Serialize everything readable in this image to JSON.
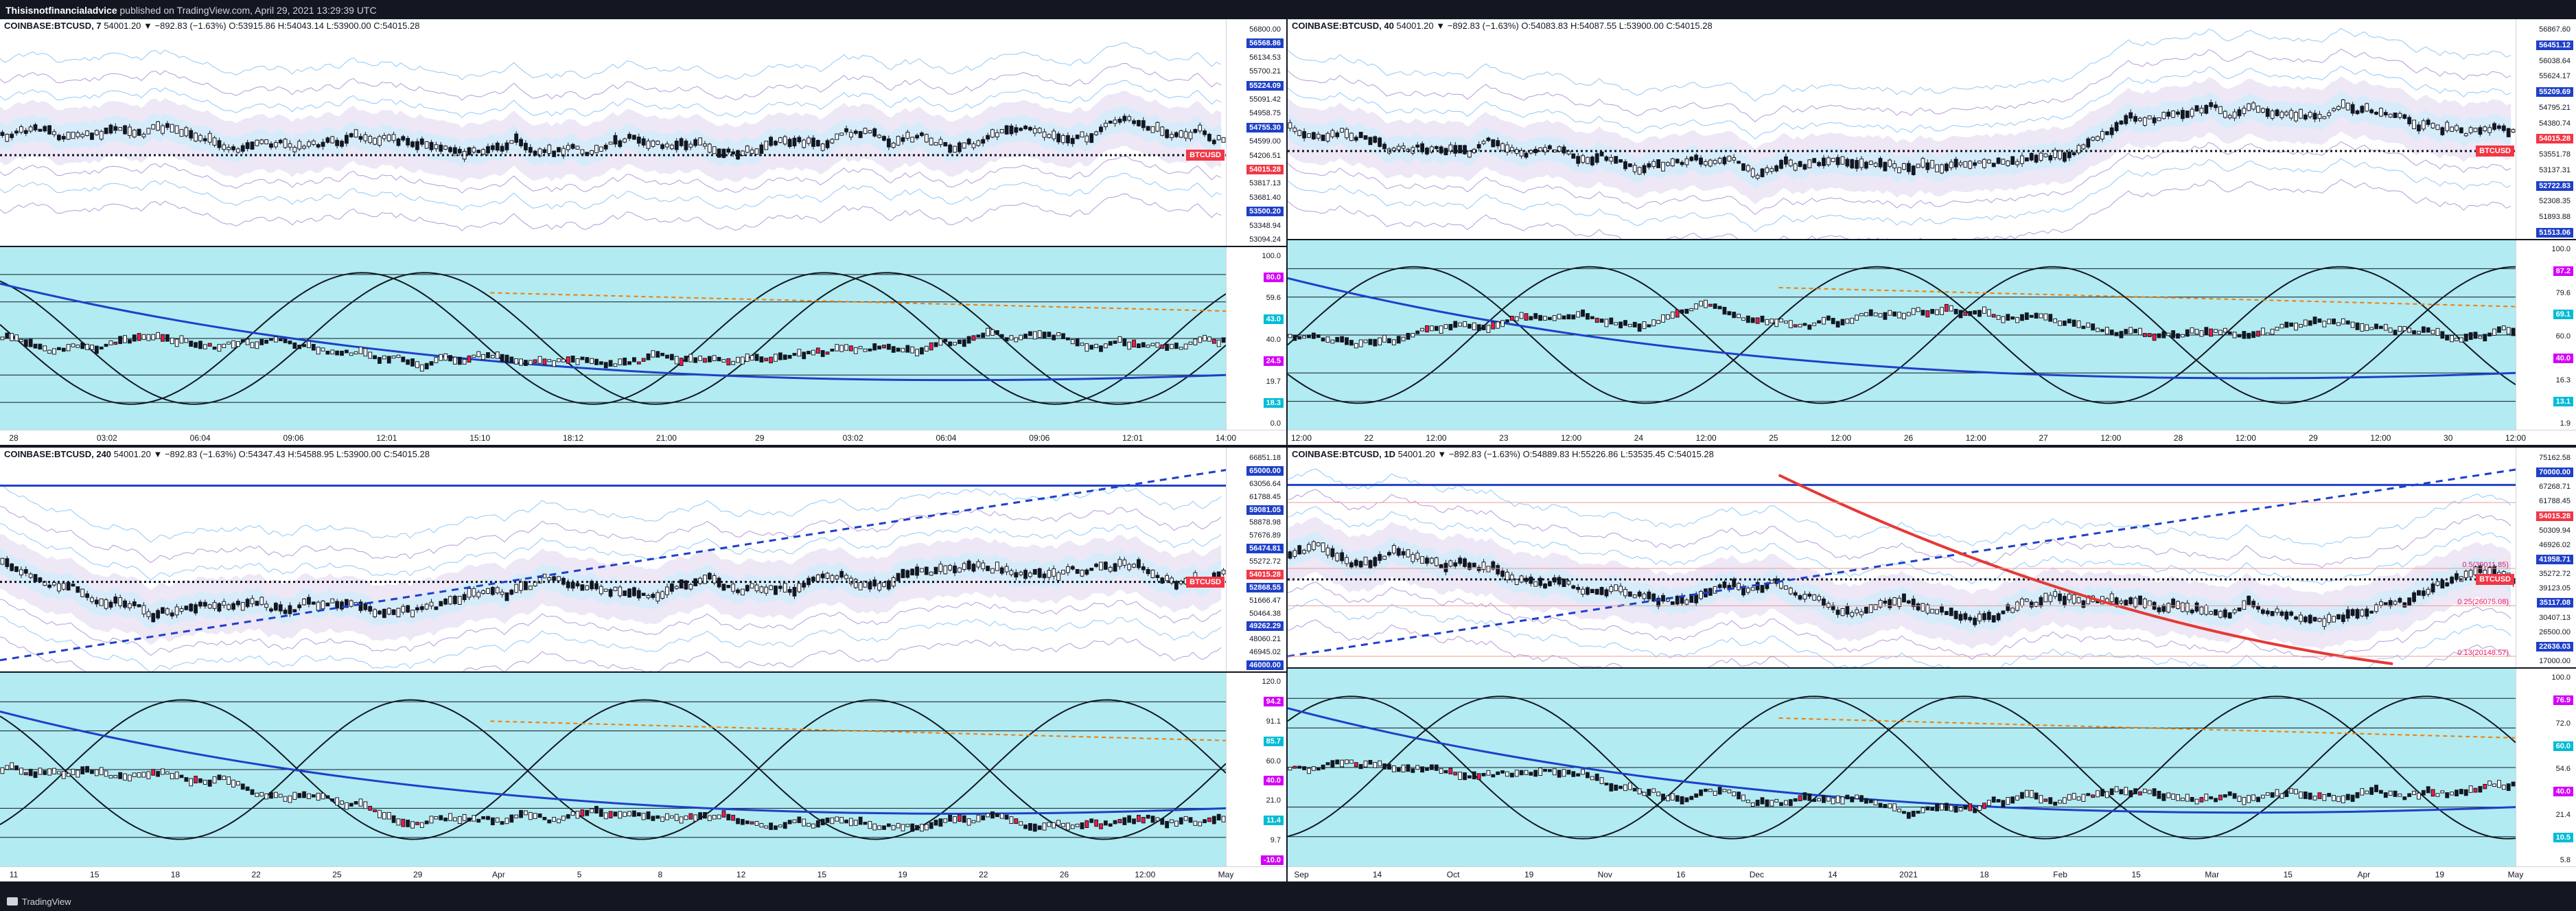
{
  "header": {
    "author": "Thisisnotfinancialadvice",
    "text": " published on TradingView.com, April 29, 2021 13:29:39 UTC"
  },
  "footer": {
    "brand": "TradingView"
  },
  "colors": {
    "up": "#26a69a",
    "down": "#ef5350",
    "cross_high": "#ff1744",
    "osc_bg": "#b2ebf2",
    "band": "#b39ddb",
    "price_tag": "#f23645",
    "dark_tag": "#131722"
  },
  "panels": [
    {
      "id": "p1",
      "symbol": "COINBASE:BTCUSD, 7",
      "ohlc": " 54001.20 ▼ −892.83 (−1.63%) O:53915.86 H:54043.14 L:53900.00 C:54015.28",
      "price_labels": [
        "56800.00",
        "56568.86",
        "56134.53",
        "55700.21",
        "55224.09",
        "55091.42",
        "54958.75",
        "54755.30",
        "54599.00",
        "54206.51",
        "54015.28",
        "53817.13",
        "53681.40",
        "53500.20",
        "53348.94",
        "53094.24"
      ],
      "price_tag": "BTCUSD",
      "price_value": "54015.28",
      "osc_labels": [
        "100.0",
        "80.0",
        "59.6",
        "43.0",
        "40.0",
        "24.5",
        "19.7",
        "18.3",
        "0.0"
      ],
      "x_labels": [
        "28",
        "03:02",
        "06:04",
        "09:06",
        "12:01",
        "15:10",
        "18:12",
        "21:00",
        "29",
        "03:02",
        "06:04",
        "09:06",
        "12:01",
        "14:00"
      ]
    },
    {
      "id": "p2",
      "symbol": "COINBASE:BTCUSD, 40",
      "ohlc": " 54001.20 ▼ −892.83 (−1.63%) O:54083.83 H:54087.55 L:53900.00 C:54015.28",
      "price_labels": [
        "56867.60",
        "56451.12",
        "56038.64",
        "55624.17",
        "55209.69",
        "54795.21",
        "54380.74",
        "54015.28",
        "53551.78",
        "53137.31",
        "52722.83",
        "52308.35",
        "51893.88",
        "51513.06"
      ],
      "price_tag": "BTCUSD",
      "price_value": "54015.28",
      "osc_labels": [
        "100.0",
        "87.2",
        "79.6",
        "69.1",
        "60.0",
        "40.0",
        "16.3",
        "13.1",
        "1.9"
      ],
      "x_labels": [
        "12:00",
        "22",
        "12:00",
        "23",
        "12:00",
        "24",
        "12:00",
        "25",
        "12:00",
        "26",
        "12:00",
        "27",
        "12:00",
        "28",
        "12:00",
        "29",
        "12:00",
        "30",
        "12:00"
      ]
    },
    {
      "id": "p3",
      "symbol": "COINBASE:BTCUSD, 240",
      "ohlc": " 54001.20 ▼ −892.83 (−1.63%) O:54347.43 H:54588.95 L:53900.00 C:54015.28",
      "price_labels": [
        "66851.18",
        "65000.00",
        "63056.64",
        "61788.45",
        "59081.05",
        "58878.98",
        "57676.89",
        "56474.81",
        "55272.72",
        "54015.28",
        "52868.55",
        "51666.47",
        "50464.38",
        "49262.29",
        "48060.21",
        "46945.02",
        "46000.00"
      ],
      "price_tag": "BTCUSD",
      "price_value": "54015.28",
      "osc_labels": [
        "120.0",
        "94.2",
        "91.1",
        "85.7",
        "60.0",
        "40.0",
        "21.0",
        "11.4",
        "9.7",
        "-10.0"
      ],
      "x_labels": [
        "11",
        "15",
        "18",
        "22",
        "25",
        "29",
        "Apr",
        "5",
        "8",
        "12",
        "15",
        "19",
        "22",
        "26",
        "12:00",
        "May"
      ]
    },
    {
      "id": "p4",
      "symbol": "COINBASE:BTCUSD, 1D",
      "ohlc": " 54001.20 ▼ −892.83 (−1.63%) O:54889.83 H:55226.86 L:53535.45 C:54015.28",
      "price_labels": [
        "75162.58",
        "70000.00",
        "67268.71",
        "61788.45",
        "54015.28",
        "50309.94",
        "46926.02",
        "41958.71",
        "35272.72",
        "39123.05",
        "35117.08",
        "30407.13",
        "26500.00",
        "22636.03",
        "17000.00"
      ],
      "price_tag": "BTCUSD",
      "price_value": "54015.28",
      "fib_labels": [
        "0.5(39011.85)",
        "0.25(26075.08)",
        "0.13(20148.57)"
      ],
      "osc_labels": [
        "100.0",
        "76.9",
        "72.0",
        "60.0",
        "54.6",
        "40.0",
        "21.4",
        "10.5",
        "5.8"
      ],
      "x_labels": [
        "Sep",
        "14",
        "Oct",
        "19",
        "Nov",
        "16",
        "Dec",
        "14",
        "2021",
        "18",
        "Feb",
        "15",
        "Mar",
        "15",
        "Apr",
        "19",
        "May"
      ]
    }
  ]
}
